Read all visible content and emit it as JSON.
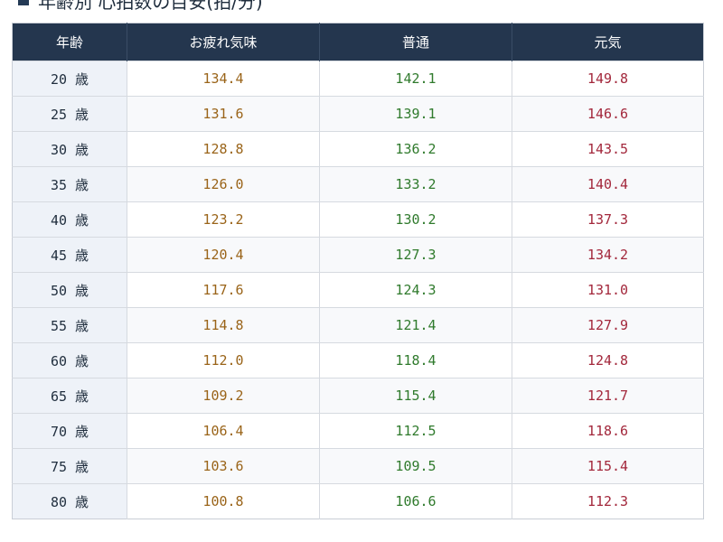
{
  "heading": {
    "text": "年齢別 心拍数の目安(拍/分)"
  },
  "table": {
    "headers": [
      "年齢",
      "お疲れ気味",
      "普通",
      "元気"
    ],
    "column_colors": {
      "age": "#1f2d3d",
      "tired": "#9a6419",
      "normal": "#2f7a2c",
      "genki": "#a3283c"
    },
    "rows": [
      {
        "age": "20 歳",
        "tired": "134.4",
        "normal": "142.1",
        "genki": "149.8"
      },
      {
        "age": "25 歳",
        "tired": "131.6",
        "normal": "139.1",
        "genki": "146.6"
      },
      {
        "age": "30 歳",
        "tired": "128.8",
        "normal": "136.2",
        "genki": "143.5"
      },
      {
        "age": "35 歳",
        "tired": "126.0",
        "normal": "133.2",
        "genki": "140.4"
      },
      {
        "age": "40 歳",
        "tired": "123.2",
        "normal": "130.2",
        "genki": "137.3"
      },
      {
        "age": "45 歳",
        "tired": "120.4",
        "normal": "127.3",
        "genki": "134.2"
      },
      {
        "age": "50 歳",
        "tired": "117.6",
        "normal": "124.3",
        "genki": "131.0"
      },
      {
        "age": "55 歳",
        "tired": "114.8",
        "normal": "121.4",
        "genki": "127.9"
      },
      {
        "age": "60 歳",
        "tired": "112.0",
        "normal": "118.4",
        "genki": "124.8"
      },
      {
        "age": "65 歳",
        "tired": "109.2",
        "normal": "115.4",
        "genki": "121.7"
      },
      {
        "age": "70 歳",
        "tired": "106.4",
        "normal": "112.5",
        "genki": "118.6"
      },
      {
        "age": "75 歳",
        "tired": "103.6",
        "normal": "109.5",
        "genki": "115.4"
      },
      {
        "age": "80 歳",
        "tired": "100.8",
        "normal": "106.6",
        "genki": "112.3"
      }
    ]
  }
}
